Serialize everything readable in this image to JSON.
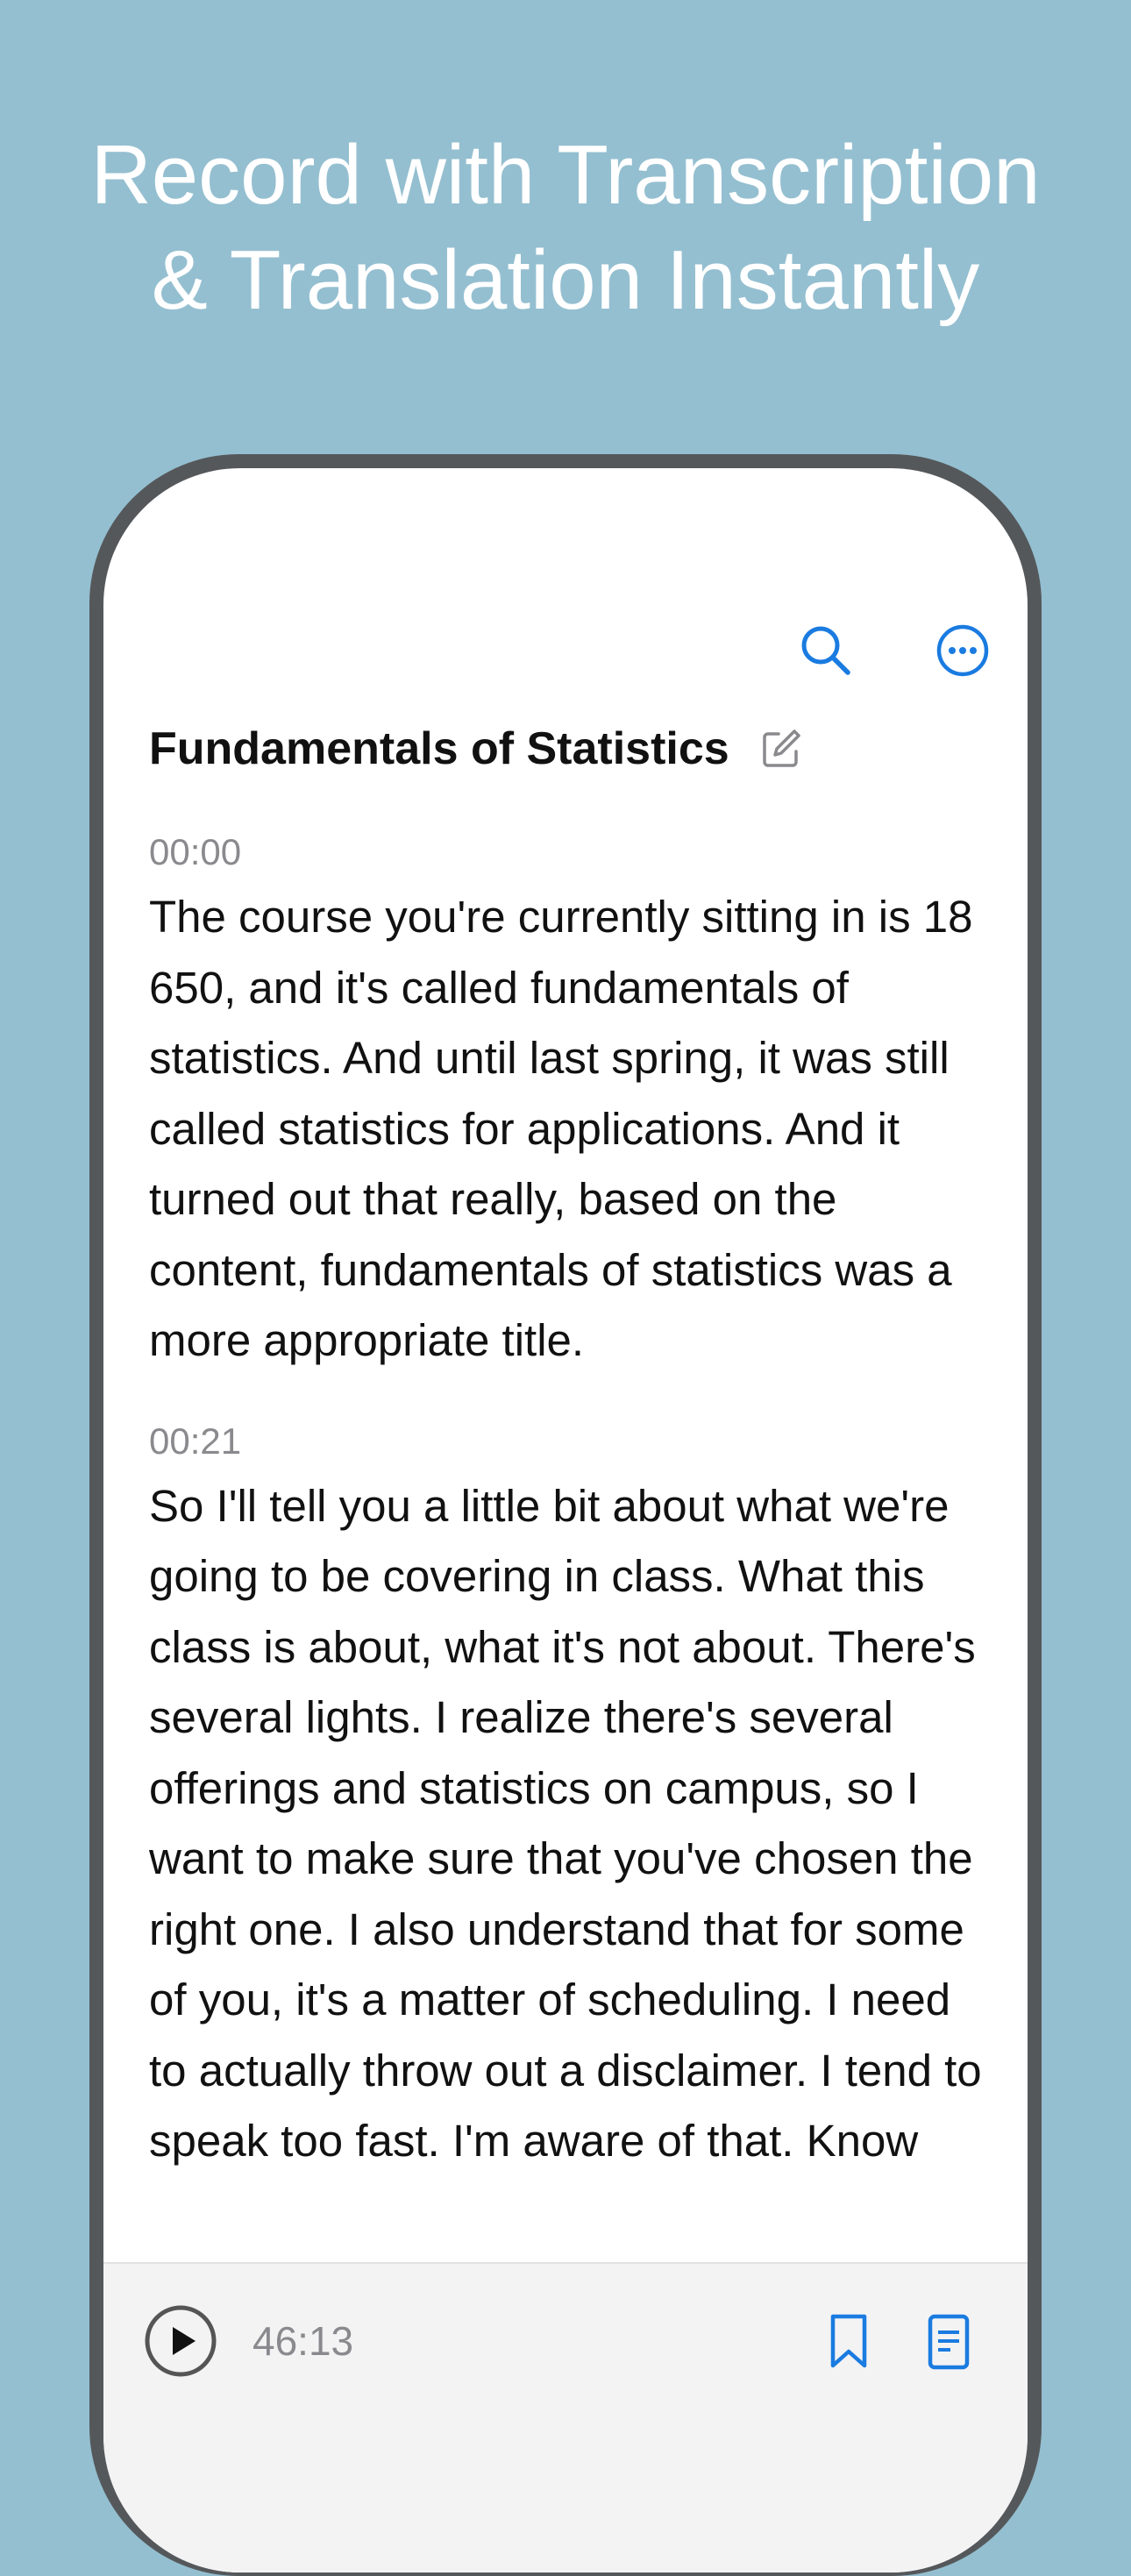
{
  "headline": {
    "line1": "Record with Transcription",
    "line2": "& Translation Instantly"
  },
  "toolbar": {
    "search_icon": "search-icon",
    "more_icon": "ellipsis-circle-icon"
  },
  "recording": {
    "title": "Fundamentals of Statistics",
    "edit_icon": "compose-icon"
  },
  "transcript": {
    "segments": [
      {
        "timestamp": "00:00",
        "text": "The course you're currently sitting in is 18 650, and it's called fundamentals of statistics. And until last spring, it was still called statistics for applications. And it turned out that really, based on the content, fundamentals of statistics was a more appropriate title."
      },
      {
        "timestamp": "00:21",
        "text": "So I'll tell you a little bit about what we're going to be covering in class. What this class is about, what it's not about. There's several lights. I realize there's several offerings and statistics on campus, so I want to make sure that you've chosen the right one. I also understand that for some of you, it's a matter of scheduling. I need to actually throw out a disclaimer. I tend to speak too fast. I'm aware of that. Know"
      }
    ]
  },
  "player": {
    "duration": "46:13",
    "play_icon": "play-circle-icon",
    "bookmark_icon": "bookmark-icon",
    "transcript_icon": "document-icon"
  },
  "colors": {
    "background": "#94bfd0",
    "accent": "#1a7be0",
    "frame": "#55585b"
  }
}
